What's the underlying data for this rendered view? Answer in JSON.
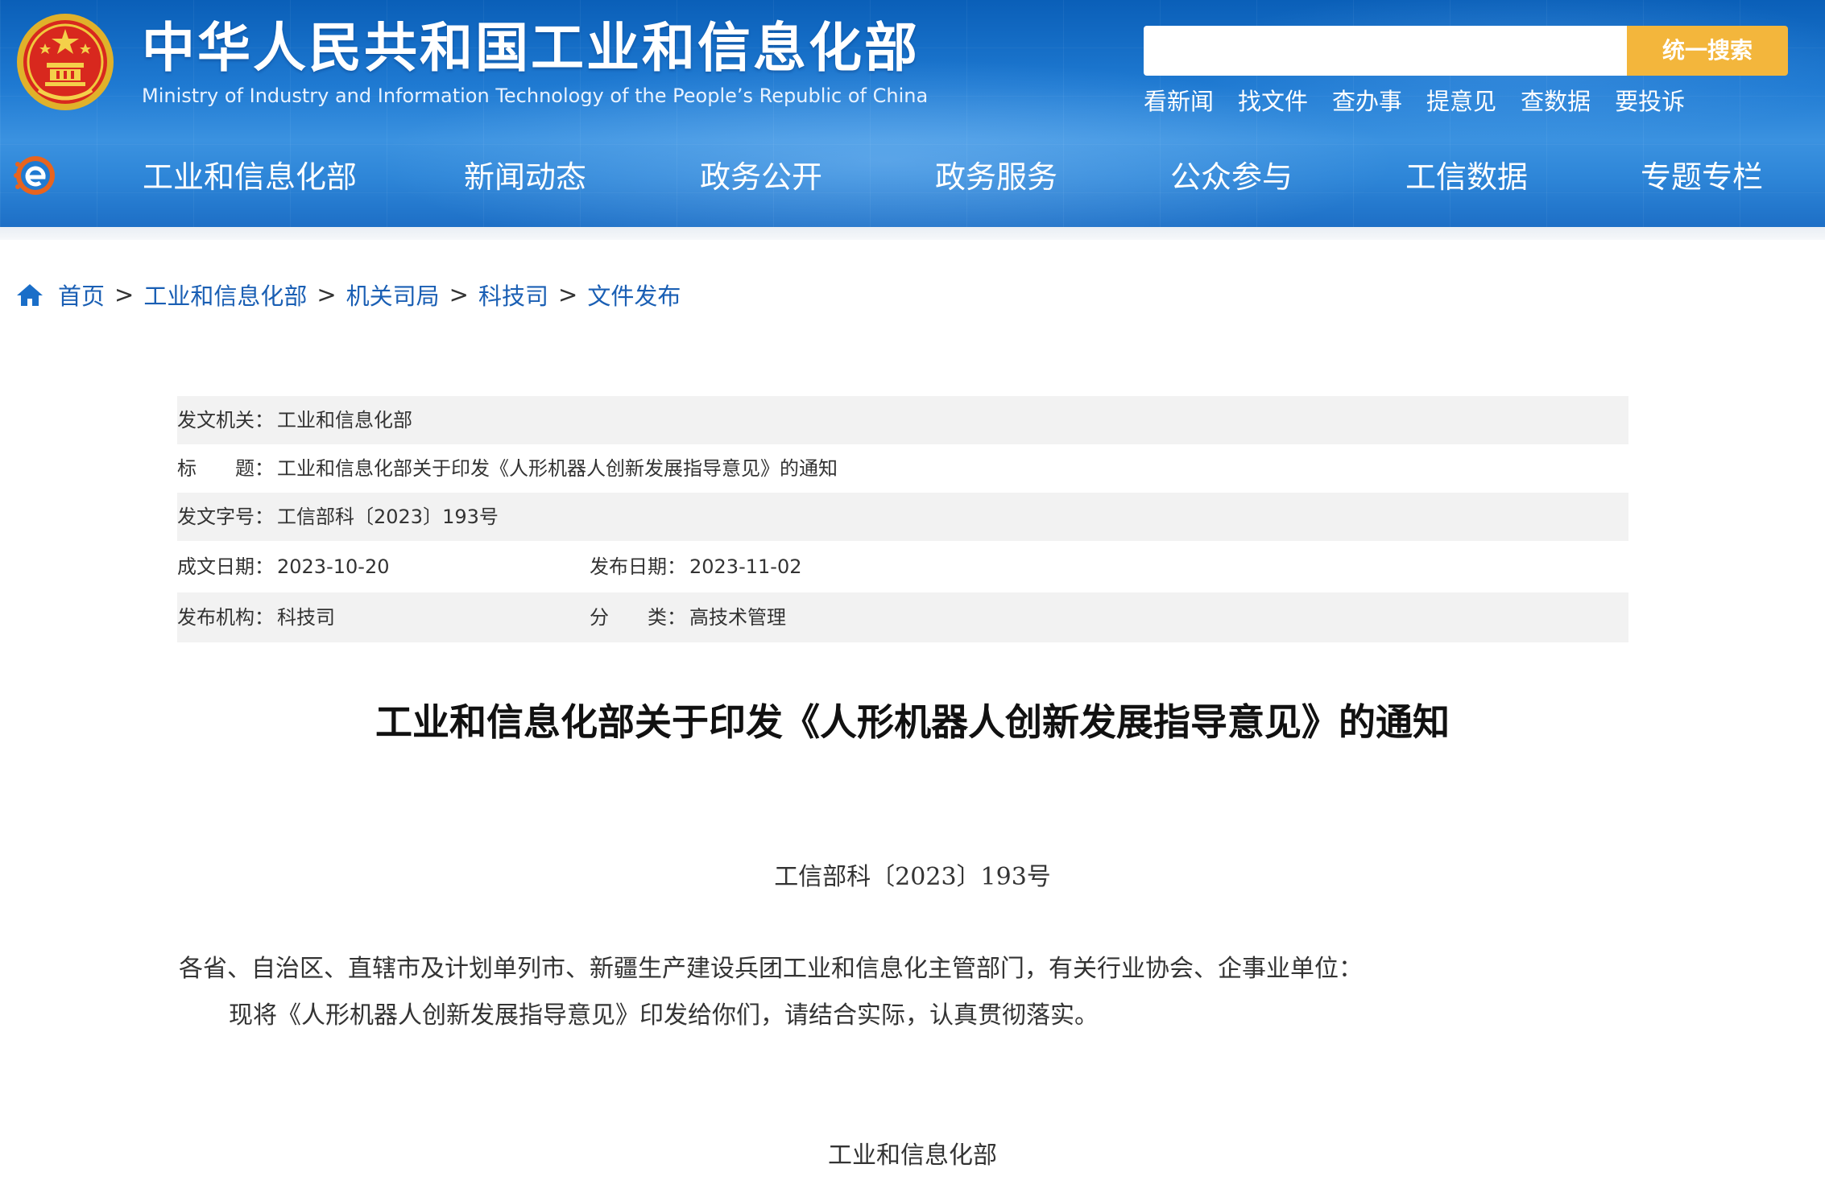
{
  "header": {
    "site_title_cn": "中华人民共和国工业和信息化部",
    "site_title_en": "Ministry of Industry and Information Technology of the People’s Republic of China",
    "search": {
      "placeholder": "",
      "value": "",
      "button_label": "统一搜索"
    },
    "quick_links": [
      "看新闻",
      "找文件",
      "查办事",
      "提意见",
      "查数据",
      "要投诉"
    ],
    "nav": [
      "工业和信息化部",
      "新闻动态",
      "政务公开",
      "政务服务",
      "公众参与",
      "工信数据",
      "专题专栏"
    ],
    "colors": {
      "primary_blue": "#1f7ad2",
      "search_button": "#f3b63c"
    }
  },
  "breadcrumb": {
    "icon": "home-icon",
    "items": [
      "首页",
      "工业和信息化部",
      "机关司局",
      "科技司",
      "文件发布"
    ],
    "separator": ">"
  },
  "meta": {
    "issuer": {
      "label": "发文机关：",
      "value": "工业和信息化部"
    },
    "title": {
      "label": "标　　题：",
      "value": "工业和信息化部关于印发《人形机器人创新发展指导意见》的通知"
    },
    "doc_number": {
      "label": "发文字号：",
      "value": "工信部科〔2023〕193号"
    },
    "written_date": {
      "label": "成文日期：",
      "value": "2023-10-20"
    },
    "publish_date": {
      "label": "发布日期：",
      "value": "2023-11-02"
    },
    "publisher": {
      "label": "发布机构：",
      "value": "科技司"
    },
    "category": {
      "label": "分　　类：",
      "value": "高技术管理"
    }
  },
  "article": {
    "title": "工业和信息化部关于印发《人形机器人创新发展指导意见》的通知",
    "doc_number": "工信部科〔2023〕193号",
    "salutation": "各省、自治区、直辖市及计划单列市、新疆生产建设兵团工业和信息化主管部门，有关行业协会、企事业单位：",
    "body": "现将《人形机器人创新发展指导意见》印发给你们，请结合实际，认真贯彻落实。",
    "signature": "工业和信息化部"
  }
}
